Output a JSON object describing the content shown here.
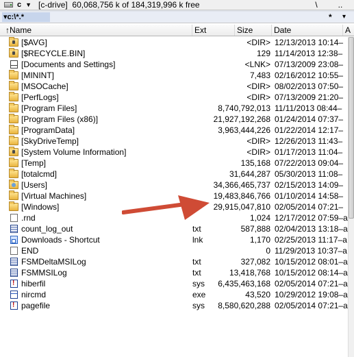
{
  "drive_bar": {
    "drive_letter": "c",
    "drive_label": "[c-drive]",
    "free_space": "60,068,756 k of 184,319,996 k free",
    "root_button": "\\",
    "parent_button": ".."
  },
  "path_bar": {
    "path": "▾c:\\*.*",
    "filter_star": "*",
    "history_chevron": "▾"
  },
  "columns": {
    "name": "↑Name",
    "ext": "Ext",
    "size": "Size",
    "date": "Date",
    "attr": "A"
  },
  "colors": {
    "header_bg": "#ececec",
    "path_highlight": "#c7d5ec",
    "arrow": "#cf4b35",
    "folder_yellow": "#f2c860"
  },
  "rows": [
    {
      "icon": "folder-lock-icon",
      "name": "[$AVG]",
      "ext": "",
      "size": "<DIR>",
      "date": "12/13/2013 10:14–"
    },
    {
      "icon": "folder-lock-icon",
      "name": "[$RECYCLE.BIN]",
      "ext": "",
      "size": "129",
      "date": "11/14/2013 12:38–"
    },
    {
      "icon": "documents-link-icon",
      "name": "[Documents and Settings]",
      "ext": "",
      "size": "<LNK>",
      "date": "07/13/2009 23:08–"
    },
    {
      "icon": "folder-icon",
      "name": "[MININT]",
      "ext": "",
      "size": "7,483",
      "date": "02/16/2012 10:55–"
    },
    {
      "icon": "folder-icon",
      "name": "[MSOCache]",
      "ext": "",
      "size": "<DIR>",
      "date": "08/02/2013 07:50–"
    },
    {
      "icon": "folder-icon",
      "name": "[PerfLogs]",
      "ext": "",
      "size": "<DIR>",
      "date": "07/13/2009 21:20–"
    },
    {
      "icon": "folder-icon",
      "name": "[Program Files]",
      "ext": "",
      "size": "8,740,792,013",
      "date": "11/11/2013 08:44–"
    },
    {
      "icon": "folder-icon",
      "name": "[Program Files (x86)]",
      "ext": "",
      "size": "21,927,192,268",
      "date": "01/24/2014 07:37–"
    },
    {
      "icon": "folder-icon",
      "name": "[ProgramData]",
      "ext": "",
      "size": "3,963,444,226",
      "date": "01/22/2014 12:17–"
    },
    {
      "icon": "folder-icon",
      "name": "[SkyDriveTemp]",
      "ext": "",
      "size": "<DIR>",
      "date": "12/26/2013 11:43–"
    },
    {
      "icon": "folder-lock-icon",
      "name": "[System Volume Information]",
      "ext": "",
      "size": "<DIR>",
      "date": "01/17/2013 11:04–"
    },
    {
      "icon": "folder-icon",
      "name": "[Temp]",
      "ext": "",
      "size": "135,168",
      "date": "07/22/2013 09:04–"
    },
    {
      "icon": "folder-icon",
      "name": "[totalcmd]",
      "ext": "",
      "size": "31,644,287",
      "date": "05/30/2013 11:08–"
    },
    {
      "icon": "folder-users-icon",
      "name": "[Users]",
      "ext": "",
      "size": "34,366,465,737",
      "date": "02/15/2013 14:09–"
    },
    {
      "icon": "folder-icon",
      "name": "[Virtual Machines]",
      "ext": "",
      "size": "19,483,846,766",
      "date": "01/10/2014 14:58–"
    },
    {
      "icon": "folder-icon",
      "name": "[Windows]",
      "ext": "",
      "size": "29,915,047,810",
      "date": "02/05/2014 07:21–"
    },
    {
      "icon": "file-icon",
      "name": ".rnd",
      "ext": "",
      "size": "1,024",
      "date": "12/17/2012 07:59–a"
    },
    {
      "icon": "text-file-icon",
      "name": "count_log_out",
      "ext": "txt",
      "size": "587,888",
      "date": "02/04/2013 13:18–a"
    },
    {
      "icon": "shortcut-icon",
      "name": "Downloads - Shortcut",
      "ext": "lnk",
      "size": "1,170",
      "date": "02/25/2013 11:17–a"
    },
    {
      "icon": "file-icon",
      "name": "END",
      "ext": "",
      "size": "0",
      "date": "11/29/2013 10:37–a"
    },
    {
      "icon": "text-file-icon",
      "name": "FSMDeltaMSILog",
      "ext": "txt",
      "size": "327,082",
      "date": "10/15/2012 08:01–a"
    },
    {
      "icon": "text-file-icon",
      "name": "FSMMSILog",
      "ext": "txt",
      "size": "13,418,768",
      "date": "10/15/2012 08:14–a"
    },
    {
      "icon": "system-file-icon",
      "name": "hiberfil",
      "ext": "sys",
      "size": "6,435,463,168",
      "date": "02/05/2014 07:21–a"
    },
    {
      "icon": "executable-icon",
      "name": "nircmd",
      "ext": "exe",
      "size": "43,520",
      "date": "10/29/2012 19:08–a"
    },
    {
      "icon": "system-file-icon",
      "name": "pagefile",
      "ext": "sys",
      "size": "8,580,620,288",
      "date": "02/05/2014 07:21–a"
    }
  ]
}
